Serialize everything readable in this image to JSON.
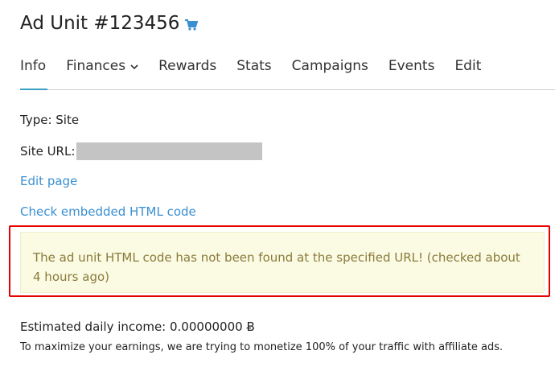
{
  "header": {
    "title": "Ad Unit #123456",
    "cart_icon": "shopping-cart-icon",
    "accent_color": "#3a8fd1"
  },
  "tabs": [
    {
      "label": "Info",
      "active": true
    },
    {
      "label": "Finances",
      "has_dropdown": true
    },
    {
      "label": "Rewards"
    },
    {
      "label": "Stats"
    },
    {
      "label": "Campaigns"
    },
    {
      "label": "Events"
    },
    {
      "label": "Edit"
    }
  ],
  "info": {
    "type_text": "Type: Site",
    "site_url_label": "Site URL:",
    "edit_page_link": "Edit page",
    "check_code_link": "Check embedded HTML code"
  },
  "warning": {
    "message": "The ad unit HTML code has not been found at the specified URL! (checked about 4 hours ago)",
    "highlight_color": "#e60000"
  },
  "income": {
    "text": "Estimated daily income: 0.00000000",
    "currency_symbol": "Ƀ",
    "note": "To maximize your earnings, we are trying to monetize 100% of your traffic with affiliate ads."
  }
}
